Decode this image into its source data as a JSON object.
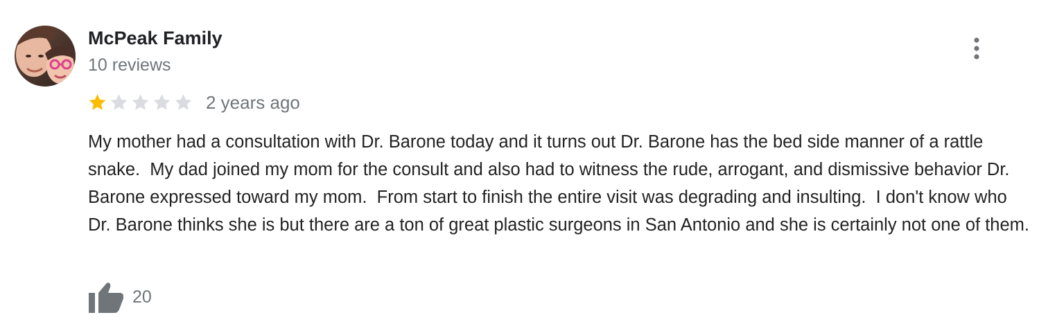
{
  "review": {
    "author_name": "McPeak Family",
    "review_count": "10 reviews",
    "rating": 1,
    "max_rating": 5,
    "date": "2 years ago",
    "text": "My mother had a consultation with Dr. Barone today and it turns out Dr. Barone has the bed side manner of a rattle snake.  My dad joined my mom for the consult and also had to witness the rude, arrogant, and dismissive behavior Dr. Barone expressed toward my mom.  From start to finish the entire visit was degrading and insulting.  I don't know who Dr. Barone thinks she is but there are a ton of great plastic surgeons in San Antonio and she is certainly not one of them.",
    "likes": "20"
  },
  "icons": {
    "more": "more-vert-icon",
    "like": "thumbs-up-icon",
    "star_filled": "star-filled-icon",
    "star_empty": "star-empty-icon"
  },
  "colors": {
    "star_filled": "#fbbc04",
    "star_empty": "#dadce0",
    "secondary_text": "#70757a",
    "icon_gray": "#70757a"
  }
}
